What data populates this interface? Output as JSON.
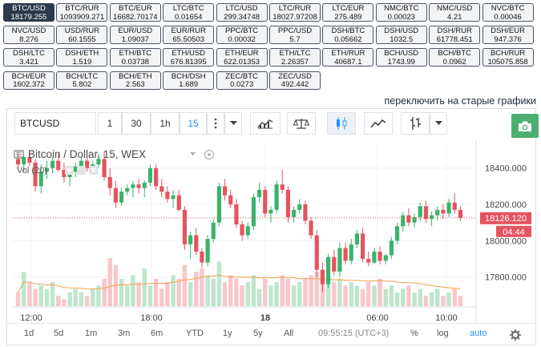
{
  "pairs": [
    {
      "name": "BTC/USD",
      "price": "18179.255",
      "active": true
    },
    {
      "name": "BTC/RUR",
      "price": "1093909.271"
    },
    {
      "name": "BTC/EUR",
      "price": "16682.70174"
    },
    {
      "name": "LTC/BTC",
      "price": "0.01654"
    },
    {
      "name": "LTC/USD",
      "price": "299.34748"
    },
    {
      "name": "LTC/RUR",
      "price": "18027.97208"
    },
    {
      "name": "LTC/EUR",
      "price": "275.489"
    },
    {
      "name": "NMC/BTC",
      "price": "0.00023"
    },
    {
      "name": "NMC/USD",
      "price": "4.21"
    },
    {
      "name": "NVC/BTC",
      "price": "0.00046"
    },
    {
      "name": "NVC/USD",
      "price": "8.276"
    },
    {
      "name": "USD/RUR",
      "price": "60.1555"
    },
    {
      "name": "EUR/USD",
      "price": "1.09037"
    },
    {
      "name": "EUR/RUR",
      "price": "65.50503"
    },
    {
      "name": "PPC/BTC",
      "price": "0.00032"
    },
    {
      "name": "PPC/USD",
      "price": "5.7"
    },
    {
      "name": "DSH/BTC",
      "price": "0.05662"
    },
    {
      "name": "DSH/USD",
      "price": "1032.5"
    },
    {
      "name": "DSH/RUR",
      "price": "61778.451"
    },
    {
      "name": "DSH/EUR",
      "price": "947.376"
    },
    {
      "name": "DSH/LTC",
      "price": "3.421"
    },
    {
      "name": "DSH/ETH",
      "price": "1.519"
    },
    {
      "name": "ETH/BTC",
      "price": "0.03738"
    },
    {
      "name": "ETH/USD",
      "price": "676.81395"
    },
    {
      "name": "ETH/EUR",
      "price": "622.01353"
    },
    {
      "name": "ETH/LTC",
      "price": "2.26357"
    },
    {
      "name": "ETH/RUR",
      "price": "40687.1"
    },
    {
      "name": "BCH/USD",
      "price": "1743.99"
    },
    {
      "name": "BCH/BTC",
      "price": "0.0962"
    },
    {
      "name": "BCH/RUR",
      "price": "105075.858"
    },
    {
      "name": "BCH/EUR",
      "price": "1602.372"
    },
    {
      "name": "BCH/LTC",
      "price": "5.802"
    },
    {
      "name": "BCH/ETH",
      "price": "2.563"
    },
    {
      "name": "BCH/DSH",
      "price": "1.689"
    },
    {
      "name": "ZEC/BTC",
      "price": "0.0273"
    },
    {
      "name": "ZEC/USD",
      "price": "492.442"
    }
  ],
  "old_charts_link": "переключить на старые графики",
  "toolbar": {
    "symbol": "BTCUSD",
    "intervals": [
      "1",
      "30",
      "1h",
      "15"
    ],
    "selected_interval": "15",
    "icons": [
      "more-vertical-icon",
      "dropdown-arrow-icon",
      "indicators-icon",
      "compare-scale-icon",
      "candlestick-icon",
      "line-chart-icon",
      "bar-style-icon",
      "dropdown-arrow-icon",
      "camera-icon"
    ],
    "accent_camera": "#4caf72"
  },
  "legend": {
    "title": "Bitcoin / Dollar, 15, WEX",
    "volume_label": "Vol (20)"
  },
  "price_axis": {
    "ticks": [
      "18400.000",
      "18200.000",
      "18000.000",
      "17800.000"
    ],
    "current_price": "18126.120",
    "countdown": "04:44",
    "current_color": "#e5535e"
  },
  "time_axis": {
    "ticks": [
      "12:00",
      "18:00",
      "18",
      "06:00",
      "10:00"
    ]
  },
  "bottombar": {
    "ranges": [
      "1d",
      "5d",
      "1m",
      "3m",
      "6m",
      "YTD",
      "1y",
      "5y",
      "All"
    ],
    "clock": "09:55:15 (UTC+3)",
    "percent": "%",
    "log": "log",
    "auto": "auto"
  },
  "chart_data": {
    "type": "candlestick",
    "title": "Bitcoin / Dollar, 15, WEX",
    "ylim": [
      17640,
      18540
    ],
    "yticks": [
      18400,
      18200,
      18000,
      17800
    ],
    "current_price": 18126.12,
    "colors": {
      "up": "#3bb36c",
      "down": "#e5535e",
      "up_vol": "#bfe6cc",
      "down_vol": "#f8c7cb",
      "ma": "#f0a04a"
    },
    "candles": [
      [
        18450,
        18490,
        18390,
        18420
      ],
      [
        18420,
        18470,
        18380,
        18460
      ],
      [
        18460,
        18500,
        18410,
        18430
      ],
      [
        18430,
        18450,
        18270,
        18300
      ],
      [
        18300,
        18420,
        18260,
        18380
      ],
      [
        18380,
        18440,
        18340,
        18400
      ],
      [
        18400,
        18460,
        18370,
        18440
      ],
      [
        18440,
        18480,
        18380,
        18390
      ],
      [
        18390,
        18430,
        18320,
        18350
      ],
      [
        18350,
        18400,
        18300,
        18380
      ],
      [
        18380,
        18430,
        18350,
        18410
      ],
      [
        18410,
        18460,
        18380,
        18440
      ],
      [
        18440,
        18470,
        18380,
        18400
      ],
      [
        18400,
        18440,
        18370,
        18420
      ],
      [
        18420,
        18480,
        18400,
        18450
      ],
      [
        18450,
        18490,
        18330,
        18350
      ],
      [
        18350,
        18400,
        18250,
        18290
      ],
      [
        18290,
        18330,
        18180,
        18210
      ],
      [
        18210,
        18290,
        18190,
        18270
      ],
      [
        18270,
        18310,
        18250,
        18290
      ],
      [
        18290,
        18330,
        18240,
        18310
      ],
      [
        18310,
        18340,
        18260,
        18290
      ],
      [
        18290,
        18330,
        18240,
        18320
      ],
      [
        18320,
        18420,
        18300,
        18400
      ],
      [
        18400,
        18420,
        18280,
        18300
      ],
      [
        18300,
        18340,
        18240,
        18270
      ],
      [
        18270,
        18300,
        18210,
        18230
      ],
      [
        18230,
        18280,
        18180,
        18250
      ],
      [
        18250,
        18280,
        18160,
        18170
      ],
      [
        18170,
        18190,
        17950,
        17980
      ],
      [
        17980,
        18050,
        17900,
        18030
      ],
      [
        18030,
        18070,
        17920,
        17940
      ],
      [
        17940,
        17960,
        17850,
        17880
      ],
      [
        17880,
        18030,
        17860,
        18010
      ],
      [
        18010,
        18120,
        17990,
        18100
      ],
      [
        18100,
        18320,
        18080,
        18300
      ],
      [
        18300,
        18340,
        18220,
        18250
      ],
      [
        18250,
        18280,
        18180,
        18200
      ],
      [
        18200,
        18230,
        18070,
        18090
      ],
      [
        18090,
        18110,
        18000,
        18030
      ],
      [
        18030,
        18100,
        18010,
        18080
      ],
      [
        18080,
        18260,
        18060,
        18240
      ],
      [
        18240,
        18320,
        18210,
        18280
      ],
      [
        18280,
        18300,
        18130,
        18150
      ],
      [
        18150,
        18190,
        18100,
        18170
      ],
      [
        18170,
        18330,
        18150,
        18310
      ],
      [
        18310,
        18390,
        18260,
        18280
      ],
      [
        18280,
        18300,
        18100,
        18130
      ],
      [
        18130,
        18190,
        18100,
        18170
      ],
      [
        18170,
        18230,
        18150,
        18200
      ],
      [
        18200,
        18220,
        18090,
        18110
      ],
      [
        18110,
        18130,
        18010,
        18030
      ],
      [
        18030,
        18060,
        17800,
        17840
      ],
      [
        17840,
        17880,
        17720,
        17760
      ],
      [
        17760,
        17930,
        17740,
        17910
      ],
      [
        17910,
        17950,
        17810,
        17830
      ],
      [
        17830,
        17990,
        17800,
        17960
      ],
      [
        17960,
        17990,
        17870,
        17890
      ],
      [
        17890,
        18010,
        17870,
        17980
      ],
      [
        17980,
        18060,
        17960,
        18040
      ],
      [
        18040,
        18070,
        17880,
        17900
      ],
      [
        17900,
        17940,
        17860,
        17880
      ],
      [
        17880,
        17960,
        17870,
        17940
      ],
      [
        17940,
        17970,
        17870,
        17890
      ],
      [
        17890,
        17930,
        17870,
        17920
      ],
      [
        17920,
        18020,
        17900,
        18000
      ],
      [
        18000,
        18100,
        17980,
        18080
      ],
      [
        18080,
        18160,
        18050,
        18140
      ],
      [
        18140,
        18180,
        18080,
        18100
      ],
      [
        18100,
        18150,
        18070,
        18130
      ],
      [
        18130,
        18210,
        18110,
        18190
      ],
      [
        18190,
        18220,
        18100,
        18120
      ],
      [
        18120,
        18160,
        18080,
        18140
      ],
      [
        18140,
        18190,
        18110,
        18170
      ],
      [
        18170,
        18200,
        18120,
        18150
      ],
      [
        18150,
        18230,
        18130,
        18210
      ],
      [
        18210,
        18260,
        18150,
        18170
      ],
      [
        18170,
        18190,
        18110,
        18126
      ]
    ],
    "volumes": [
      4,
      10,
      7,
      5,
      6,
      5,
      7,
      3,
      2,
      4,
      5,
      4,
      3,
      5,
      6,
      8,
      14,
      12,
      8,
      6,
      9,
      7,
      11,
      6,
      8,
      5,
      7,
      9,
      8,
      12,
      7,
      10,
      11,
      9,
      8,
      13,
      7,
      9,
      8,
      6,
      7,
      9,
      5,
      8,
      6,
      7,
      9,
      8,
      6,
      7,
      8,
      9,
      10,
      9,
      8,
      7,
      8,
      6,
      7,
      6,
      5,
      7,
      6,
      8,
      5,
      6,
      4,
      5,
      6,
      4,
      5,
      3,
      4,
      5,
      3,
      4,
      5,
      3
    ]
  }
}
